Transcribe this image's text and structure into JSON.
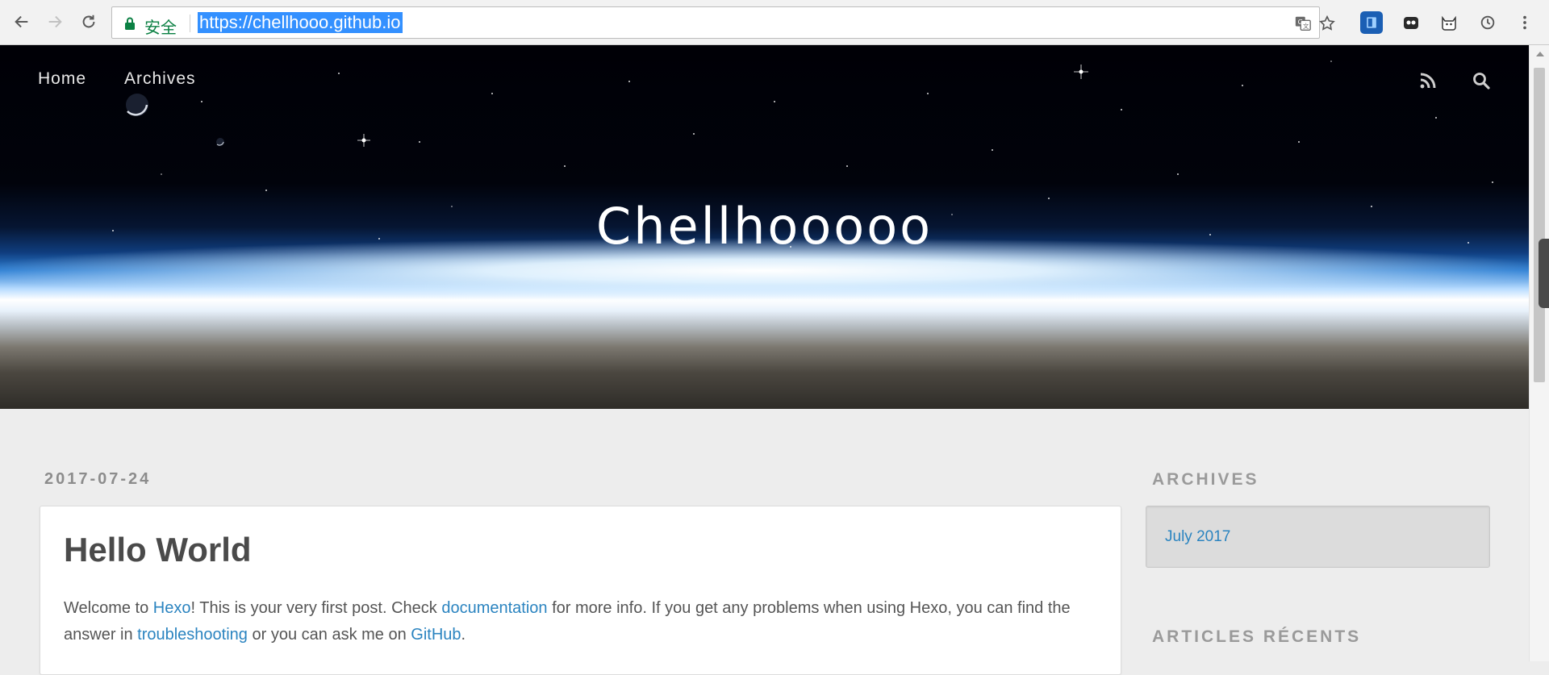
{
  "browser": {
    "secure_label": "安全",
    "url": "https://chellhooo.github.io"
  },
  "site": {
    "nav": [
      "Home",
      "Archives"
    ],
    "title": "Chellhooooo"
  },
  "post": {
    "date": "2017-07-24",
    "title": "Hello World",
    "body": {
      "t1": "Welcome to ",
      "link_hexo": "Hexo",
      "t2": "! This is your very first post. Check ",
      "link_docs": "documentation",
      "t3": " for more info. If you get any problems when using Hexo, you can find the answer in ",
      "link_troubleshooting": "troubleshooting",
      "t4": " or you can ask me on ",
      "link_github": "GitHub",
      "t5": "."
    }
  },
  "sidebar": {
    "archives_heading": "ARCHIVES",
    "archive_item": "July 2017",
    "recent_heading": "ARTICLES RÉCENTS"
  },
  "icons": {
    "back": "back-arrow-icon",
    "forward": "forward-arrow-icon",
    "reload": "reload-icon",
    "lock": "lock-icon",
    "translate": "translate-icon",
    "bookmark": "star-icon",
    "rss": "rss-icon",
    "search": "search-icon",
    "menu": "kebab-menu-icon"
  },
  "colors": {
    "link": "#2b84c0",
    "secure": "#0b8043",
    "url_highlight": "#3390ff"
  }
}
